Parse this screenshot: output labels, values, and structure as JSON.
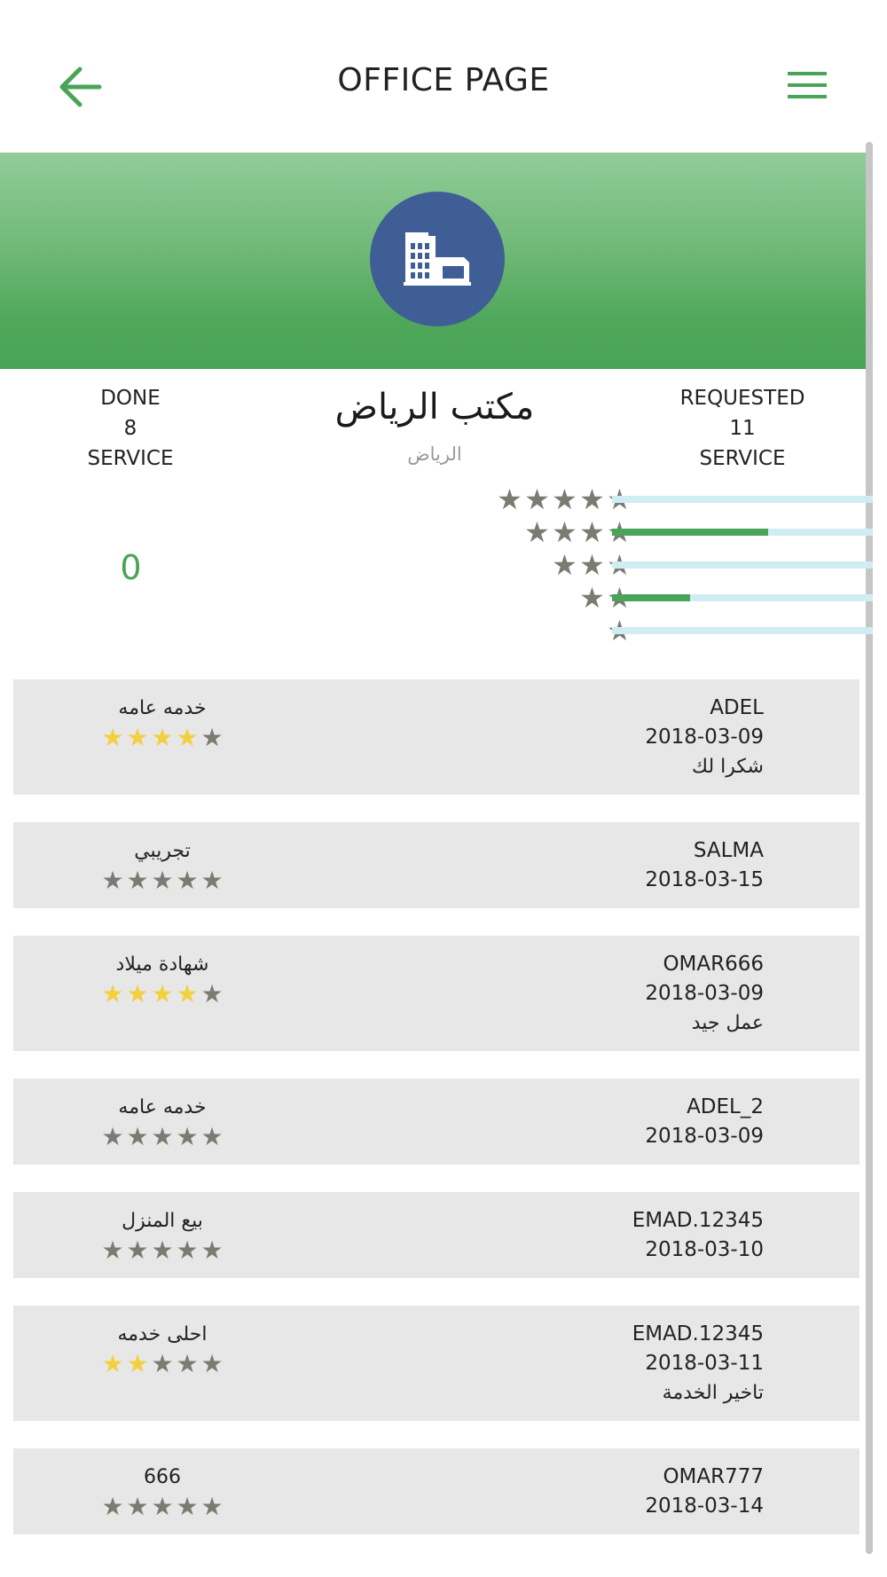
{
  "header": {
    "title": "OFFICE PAGE"
  },
  "office": {
    "name": "مكتب الرياض",
    "city": "الرياض"
  },
  "stats": {
    "done_label": "DONE",
    "done_value": "8",
    "done_unit": "SERVICE",
    "requested_label": "REQUESTED",
    "requested_value": "11",
    "requested_unit": "SERVICE",
    "rating_value": "0"
  },
  "rating_distribution": [
    {
      "stars": 5,
      "fraction": 0.0
    },
    {
      "stars": 4,
      "fraction": 0.6
    },
    {
      "stars": 3,
      "fraction": 0.0
    },
    {
      "stars": 2,
      "fraction": 0.3
    },
    {
      "stars": 1,
      "fraction": 0.0
    }
  ],
  "colors": {
    "accent_green": "#4aa457",
    "avatar_blue": "#3e5e95",
    "star_on": "#f3d03e",
    "star_off": "#7c7b71",
    "track": "#cfedf2"
  },
  "reviews": [
    {
      "user": "ADEL",
      "date": "2018-03-09",
      "comment": "شكرا لك",
      "service": "خدمه عامه",
      "rating": 4
    },
    {
      "user": "SALMA",
      "date": "2018-03-15",
      "comment": "",
      "service": "تجريبي",
      "rating": 0
    },
    {
      "user": "OMAR666",
      "date": "2018-03-09",
      "comment": "عمل جيد",
      "service": "شهادة ميلاد",
      "rating": 4
    },
    {
      "user": "ADEL_2",
      "date": "2018-03-09",
      "comment": "",
      "service": "خدمه عامه",
      "rating": 0
    },
    {
      "user": "EMAD.12345",
      "date": "2018-03-10",
      "comment": "",
      "service": "بيع المنزل",
      "rating": 0
    },
    {
      "user": "EMAD.12345",
      "date": "2018-03-11",
      "comment": "تاخير الخدمة",
      "service": "احلى خدمه",
      "rating": 2
    },
    {
      "user": "OMAR777",
      "date": "2018-03-14",
      "comment": "",
      "service": "666",
      "rating": 0
    }
  ],
  "icons": {
    "back": "arrow-left-icon",
    "menu": "hamburger-menu-icon",
    "office": "building-icon",
    "star": "star-icon"
  }
}
